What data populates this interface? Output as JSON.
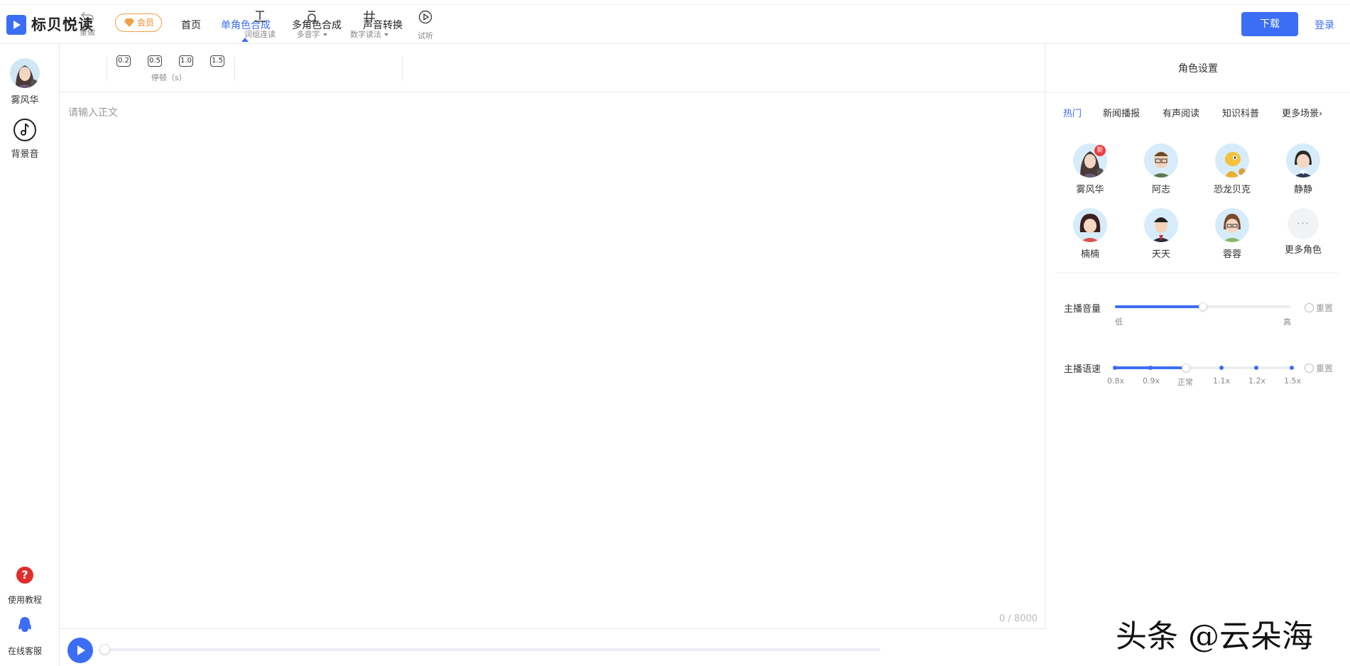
{
  "topnav": {
    "brand": "标贝悦读",
    "vip_badge": "会员",
    "items": [
      "首页",
      "单角色合成",
      "多角色合成",
      "声音转换"
    ],
    "active_index": 1,
    "download": "下载",
    "login": "登录"
  },
  "sidebar": {
    "voice_name": "雾风华",
    "bgm": "背景音",
    "tutorial": "使用教程",
    "support": "在线客服"
  },
  "toolbar": {
    "redo": "重做",
    "pause_values": [
      "0.2",
      "0.5",
      "1.0",
      "1.5"
    ],
    "pause_label": "停顿（s）",
    "phrase": "词组连读",
    "polyphone": "多音字",
    "number": "数字读法",
    "preview": "试听"
  },
  "editor": {
    "placeholder": "请输入正文",
    "counter": "0 / 8000"
  },
  "player": {
    "progress": 0
  },
  "panel": {
    "title": "角色设置",
    "tabs": [
      "热门",
      "新闻播报",
      "有声阅读",
      "知识科普",
      "更多场景"
    ],
    "active_tab": 0,
    "more_scenes_arrow": "›",
    "roles": [
      "雾风华",
      "阿志",
      "恐龙贝克",
      "静静",
      "楠楠",
      "天天",
      "蓉蓉",
      "更多角色"
    ],
    "new_tag": "新",
    "volume": {
      "label": "主播音量",
      "low": "低",
      "high": "高",
      "value_percent": 50,
      "reset": "重置"
    },
    "speed": {
      "label": "主播语速",
      "marks": [
        "0.8x",
        "0.9x",
        "正常",
        "1.1x",
        "1.2x",
        "1.5x"
      ],
      "selected": "正常",
      "reset": "重置"
    }
  },
  "watermark": "头条 @云朵海",
  "colors": {
    "accent": "#3b6ef5",
    "vip": "#e98b2a",
    "new_tag": "#ee3b3b",
    "help": "#e22d2d"
  }
}
